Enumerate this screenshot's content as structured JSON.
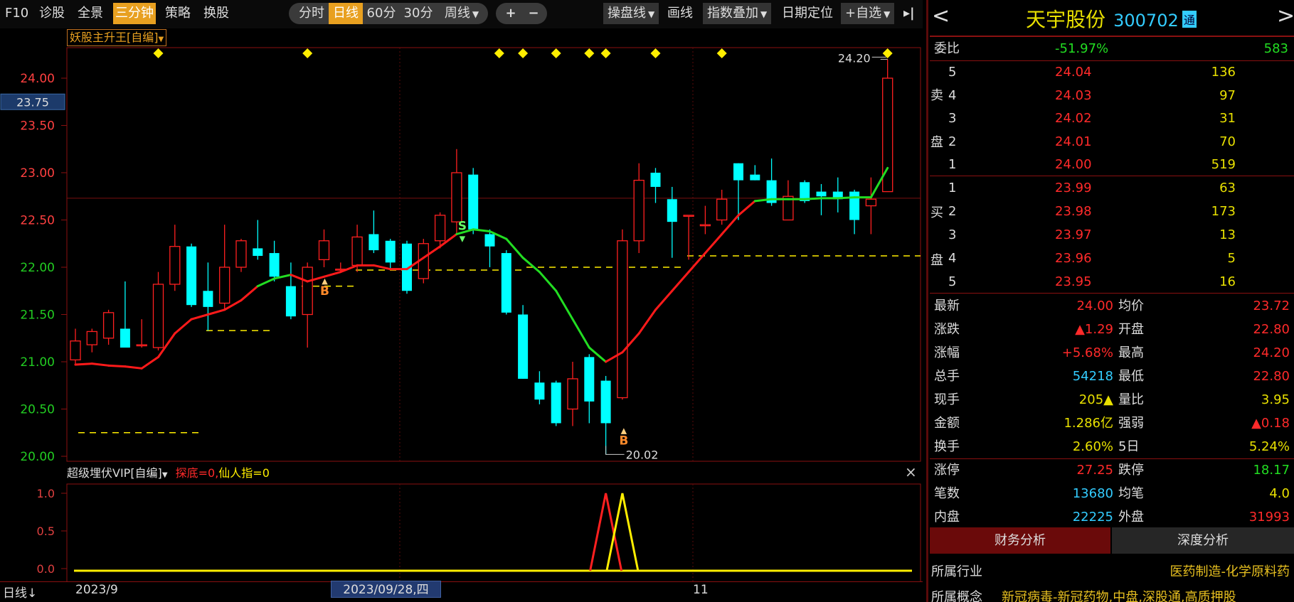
{
  "toolbar": {
    "left_items": [
      "F10",
      "诊股",
      "全景",
      "三分钟",
      "策略",
      "换股"
    ],
    "active_left": "三分钟",
    "periods": [
      "分时",
      "日线",
      "60分",
      "30分",
      "周线"
    ],
    "active_period": "日线",
    "zoom_in": "+",
    "zoom_out": "−",
    "draw_line": "操盘线",
    "draw": "画线",
    "index_overlay": "指数叠加",
    "date_locate": "日期定位",
    "add_watch": "+自选",
    "collapse": "▸|"
  },
  "main_chart": {
    "indicator": "妖股主升王[自编]",
    "price_box": "23.75",
    "high_marker": "24.20",
    "low_marker": "20.02",
    "buy_mark": "B",
    "sell_mark": "S"
  },
  "sub_chart": {
    "indicator": "超级埋伏VIP[自编]",
    "param1": "探底=0,",
    "param2": "仙人指=0",
    "close": "×"
  },
  "x_axis": {
    "left_label": "日线",
    "start": "2023/9",
    "cursor_date": "2023/09/28,四",
    "mid": "11"
  },
  "chart_data": [
    {
      "type": "candlestick",
      "ylim": [
        19.95,
        24.4
      ],
      "y_ticks": [
        "24.00",
        "23.50",
        "23.00",
        "22.50",
        "22.00",
        "21.50",
        "21.00",
        "20.50",
        "20.00"
      ],
      "candles": [
        {
          "o": 21.02,
          "h": 21.35,
          "l": 20.98,
          "c": 21.22
        },
        {
          "o": 21.18,
          "h": 21.35,
          "l": 21.1,
          "c": 21.32
        },
        {
          "o": 21.25,
          "h": 21.55,
          "l": 21.18,
          "c": 21.52
        },
        {
          "o": 21.35,
          "h": 21.85,
          "l": 21.2,
          "c": 21.15
        },
        {
          "o": 21.18,
          "h": 21.45,
          "l": 21.15,
          "c": 21.18
        },
        {
          "o": 21.15,
          "h": 21.95,
          "l": 21.12,
          "c": 21.82
        },
        {
          "o": 21.82,
          "h": 22.45,
          "l": 21.75,
          "c": 22.22
        },
        {
          "o": 22.22,
          "h": 22.25,
          "l": 21.58,
          "c": 21.6
        },
        {
          "o": 21.75,
          "h": 22.05,
          "l": 21.33,
          "c": 21.58
        },
        {
          "o": 21.62,
          "h": 22.45,
          "l": 21.55,
          "c": 22.0
        },
        {
          "o": 22.0,
          "h": 22.3,
          "l": 21.95,
          "c": 22.28
        },
        {
          "o": 22.2,
          "h": 22.5,
          "l": 22.08,
          "c": 22.12
        },
        {
          "o": 22.15,
          "h": 22.28,
          "l": 21.85,
          "c": 21.9
        },
        {
          "o": 21.8,
          "h": 22.05,
          "l": 21.45,
          "c": 21.48
        },
        {
          "o": 21.5,
          "h": 22.05,
          "l": 21.15,
          "c": 22.0
        },
        {
          "o": 22.08,
          "h": 22.4,
          "l": 22.0,
          "c": 22.28
        },
        {
          "o": 21.98,
          "h": 22.05,
          "l": 21.95,
          "c": 21.98
        },
        {
          "o": 22.02,
          "h": 22.45,
          "l": 21.95,
          "c": 22.32
        },
        {
          "o": 22.35,
          "h": 22.6,
          "l": 22.15,
          "c": 22.18
        },
        {
          "o": 22.28,
          "h": 22.3,
          "l": 21.98,
          "c": 22.05
        },
        {
          "o": 22.25,
          "h": 22.28,
          "l": 21.72,
          "c": 21.75
        },
        {
          "o": 21.88,
          "h": 22.3,
          "l": 21.83,
          "c": 22.25
        },
        {
          "o": 22.28,
          "h": 22.58,
          "l": 22.2,
          "c": 22.55
        },
        {
          "o": 22.48,
          "h": 23.25,
          "l": 22.35,
          "c": 23.0
        },
        {
          "o": 22.98,
          "h": 23.05,
          "l": 22.35,
          "c": 22.4
        },
        {
          "o": 22.35,
          "h": 22.4,
          "l": 22.0,
          "c": 22.22
        },
        {
          "o": 22.15,
          "h": 22.18,
          "l": 21.5,
          "c": 21.52
        },
        {
          "o": 21.5,
          "h": 21.6,
          "l": 20.82,
          "c": 20.82
        },
        {
          "o": 20.78,
          "h": 20.9,
          "l": 20.55,
          "c": 20.6
        },
        {
          "o": 20.78,
          "h": 20.8,
          "l": 20.32,
          "c": 20.35
        },
        {
          "o": 20.5,
          "h": 21.0,
          "l": 20.32,
          "c": 20.82
        },
        {
          "o": 21.05,
          "h": 21.08,
          "l": 20.35,
          "c": 20.58
        },
        {
          "o": 20.8,
          "h": 20.85,
          "l": 20.02,
          "c": 20.35
        },
        {
          "o": 20.62,
          "h": 22.4,
          "l": 20.6,
          "c": 22.28
        },
        {
          "o": 22.28,
          "h": 23.1,
          "l": 22.15,
          "c": 22.92
        },
        {
          "o": 23.0,
          "h": 23.05,
          "l": 22.68,
          "c": 22.85
        },
        {
          "o": 22.72,
          "h": 22.85,
          "l": 22.1,
          "c": 22.48
        },
        {
          "o": 22.55,
          "h": 22.55,
          "l": 22.08,
          "c": 22.55
        },
        {
          "o": 22.45,
          "h": 22.65,
          "l": 22.35,
          "c": 22.45
        },
        {
          "o": 22.5,
          "h": 22.82,
          "l": 22.45,
          "c": 22.72
        },
        {
          "o": 23.1,
          "h": 23.1,
          "l": 22.5,
          "c": 22.92
        },
        {
          "o": 22.98,
          "h": 23.08,
          "l": 22.92,
          "c": 22.92
        },
        {
          "o": 22.92,
          "h": 23.15,
          "l": 22.65,
          "c": 22.68
        },
        {
          "o": 22.5,
          "h": 22.92,
          "l": 22.5,
          "c": 22.75
        },
        {
          "o": 22.9,
          "h": 22.92,
          "l": 22.68,
          "c": 22.7
        },
        {
          "o": 22.8,
          "h": 22.88,
          "l": 22.55,
          "c": 22.75
        },
        {
          "o": 22.8,
          "h": 22.95,
          "l": 22.58,
          "c": 22.72
        },
        {
          "o": 22.8,
          "h": 22.82,
          "l": 22.35,
          "c": 22.5
        },
        {
          "o": 22.65,
          "h": 22.95,
          "l": 22.35,
          "c": 22.72
        },
        {
          "o": 22.8,
          "h": 24.2,
          "l": 22.8,
          "c": 24.0
        }
      ],
      "ma_line": [
        20.97,
        20.98,
        20.96,
        20.95,
        20.93,
        21.05,
        21.3,
        21.45,
        21.5,
        21.55,
        21.65,
        21.8,
        21.88,
        21.92,
        21.85,
        21.9,
        21.95,
        22.02,
        22.02,
        21.98,
        21.98,
        22.1,
        22.22,
        22.35,
        22.4,
        22.38,
        22.3,
        22.1,
        21.95,
        21.75,
        21.45,
        21.15,
        21.0,
        21.1,
        21.3,
        21.55,
        21.75,
        21.95,
        22.15,
        22.35,
        22.55,
        22.7,
        22.72,
        22.72,
        22.72,
        22.73,
        22.73,
        22.74,
        22.74,
        23.05
      ],
      "ma_green_segments": [
        [
          11,
          13
        ],
        [
          23,
          32
        ],
        [
          41,
          49
        ]
      ]
    },
    {
      "type": "line",
      "ylim": [
        0,
        1
      ],
      "y_ticks": [
        "1.0",
        "0.5",
        "0.0"
      ],
      "series": [
        {
          "name": "探底",
          "spike_at": 32,
          "color": "#ff2020"
        },
        {
          "name": "仙人指",
          "spike_at": 33,
          "color": "#ffee00"
        }
      ]
    }
  ],
  "quote": {
    "name": "天宇股份",
    "code": "300702",
    "tag": "通",
    "prev": "<",
    "next": ">",
    "weibi_label": "委比",
    "weibi_val": "-51.97%",
    "weibi_num": "583",
    "sell_label": [
      "卖",
      "盘"
    ],
    "buy_label": [
      "买",
      "盘"
    ],
    "sells": [
      {
        "lvl": "5",
        "price": "24.04",
        "vol": "136"
      },
      {
        "lvl": "4",
        "price": "24.03",
        "vol": "97"
      },
      {
        "lvl": "3",
        "price": "24.02",
        "vol": "31"
      },
      {
        "lvl": "2",
        "price": "24.01",
        "vol": "70"
      },
      {
        "lvl": "1",
        "price": "24.00",
        "vol": "519"
      }
    ],
    "buys": [
      {
        "lvl": "1",
        "price": "23.99",
        "vol": "63"
      },
      {
        "lvl": "2",
        "price": "23.98",
        "vol": "173"
      },
      {
        "lvl": "3",
        "price": "23.97",
        "vol": "13"
      },
      {
        "lvl": "4",
        "price": "23.96",
        "vol": "5"
      },
      {
        "lvl": "5",
        "price": "23.95",
        "vol": "16"
      }
    ],
    "stats": [
      {
        "k1": "最新",
        "v1": "24.00",
        "k2": "均价",
        "v2": "23.72"
      },
      {
        "k1": "涨跌",
        "v1": "▲1.29",
        "k2": "开盘",
        "v2": "22.80"
      },
      {
        "k1": "涨幅",
        "v1": "+5.68%",
        "k2": "最高",
        "v2": "24.20"
      },
      {
        "k1": "总手",
        "v1": "54218",
        "k2": "最低",
        "v2": "22.80"
      },
      {
        "k1": "现手",
        "v1": "205▲",
        "k2": "量比",
        "v2": "3.95"
      },
      {
        "k1": "金额",
        "v1": "1.286亿",
        "k2": "强弱",
        "v2": "▲0.18"
      },
      {
        "k1": "换手",
        "v1": "2.60%",
        "k2": "5日",
        "v2": "5.24%"
      },
      {
        "k1": "涨停",
        "v1": "27.25",
        "k2": "跌停",
        "v2": "18.17"
      },
      {
        "k1": "笔数",
        "v1": "13680",
        "k2": "均笔",
        "v2": "4.0"
      },
      {
        "k1": "内盘",
        "v1": "22225",
        "k2": "外盘",
        "v2": "31993"
      }
    ],
    "tabs": [
      "财务分析",
      "深度分析"
    ],
    "industry_label": "所属行业",
    "industry_val": "医药制造-化学原料药",
    "concept_label": "所属概念",
    "concept_val": "新冠病毒-新冠药物,中盘,深股通,高质押股"
  },
  "colors": {
    "up": "#ff2020",
    "down": "#00ffff",
    "ma_up": "#ff1a1a",
    "ma_down": "#22dd22",
    "yellow": "#ffee00",
    "grid": "#8a1010",
    "green_val": "#22dd22",
    "red_val": "#ff2a2a",
    "blue_val": "#33ccff",
    "gold": "#e8c020"
  }
}
